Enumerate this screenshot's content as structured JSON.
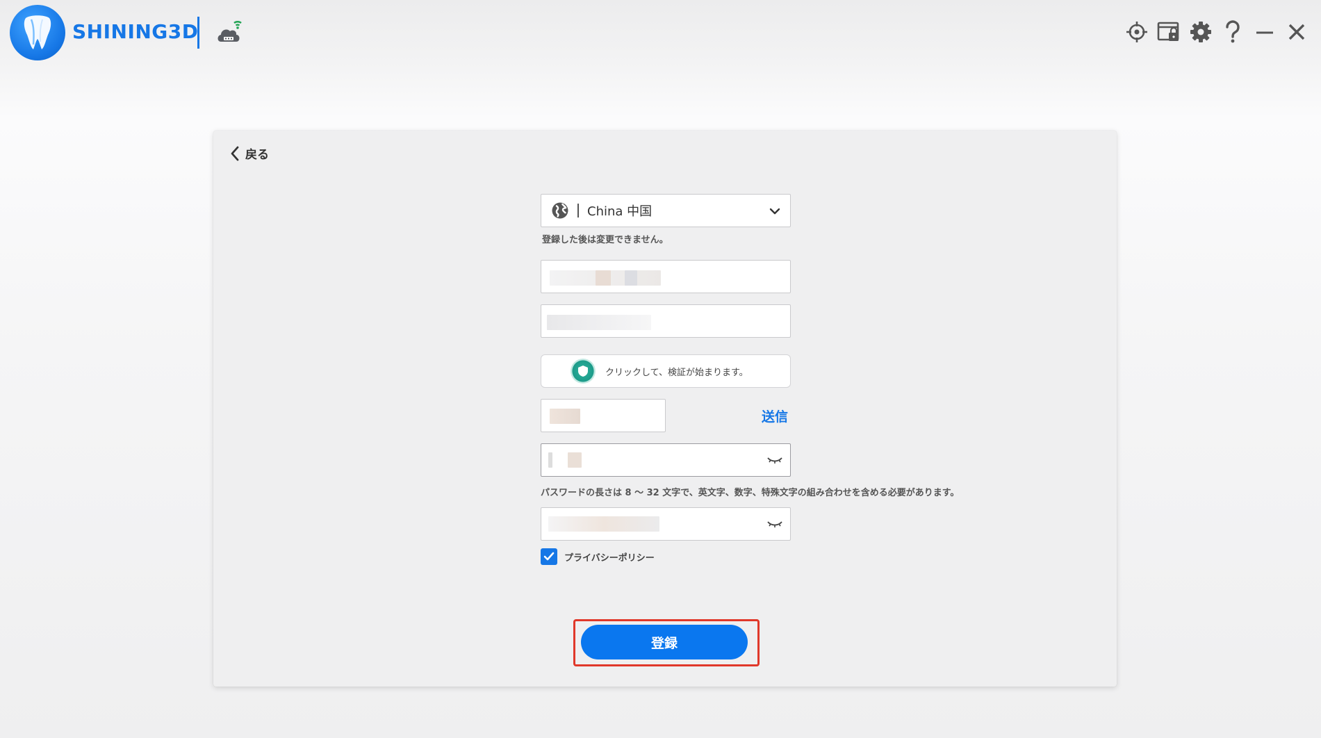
{
  "header": {
    "brand": "SHINING3D",
    "icons": [
      "tooth-logo-icon",
      "cloud-wifi-icon",
      "crosshair-icon",
      "screen-lock-icon",
      "gear-icon",
      "help-icon",
      "minimize-icon",
      "close-icon"
    ]
  },
  "card": {
    "back_label": "戻る",
    "region": {
      "value": "China 中国",
      "hint": "登録した後は変更できません。"
    },
    "captcha_text": "クリックして、検証が始まります。",
    "send_label": "送信",
    "password_hint": "パスワードの長さは 8 ～ 32 文字で、英文字、数字、特殊文字の組み合わせを含める必要があります。",
    "privacy_label": "プライバシーポリシー",
    "privacy_checked": true,
    "register_label": "登録"
  },
  "colors": {
    "accent": "#1677e6",
    "button": "#0a77ef",
    "highlight_border": "#e0382a",
    "captcha": "#1c9b89"
  }
}
